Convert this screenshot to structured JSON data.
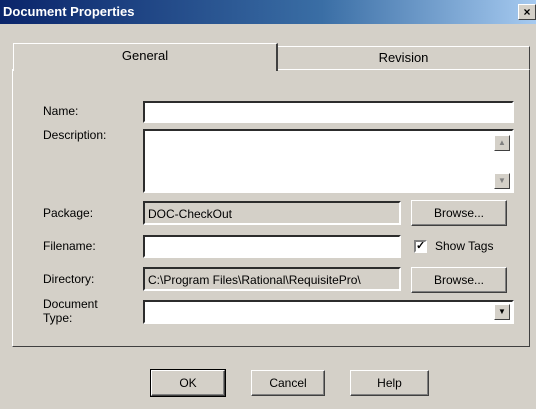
{
  "dialog": {
    "title": "Document Properties",
    "close_label": "×"
  },
  "tabs": [
    {
      "label": "General",
      "selected": true
    },
    {
      "label": "Revision",
      "selected": false
    }
  ],
  "form": {
    "name_label": "Name:",
    "name_value": "",
    "description_label": "Description:",
    "description_value": "",
    "package_label": "Package:",
    "package_value": "DOC-CheckOut",
    "filename_label": "Filename:",
    "filename_value": "",
    "show_tags_label": "Show Tags",
    "show_tags_checked": true,
    "directory_label": "Directory:",
    "directory_value": "C:\\Program Files\\Rational\\RequisitePro\\",
    "document_type_label_line1": "Document",
    "document_type_label_line2": "Type:",
    "document_type_value": "",
    "browse_label": "Browse..."
  },
  "buttons": {
    "ok": "OK",
    "cancel": "Cancel",
    "help": "Help"
  }
}
